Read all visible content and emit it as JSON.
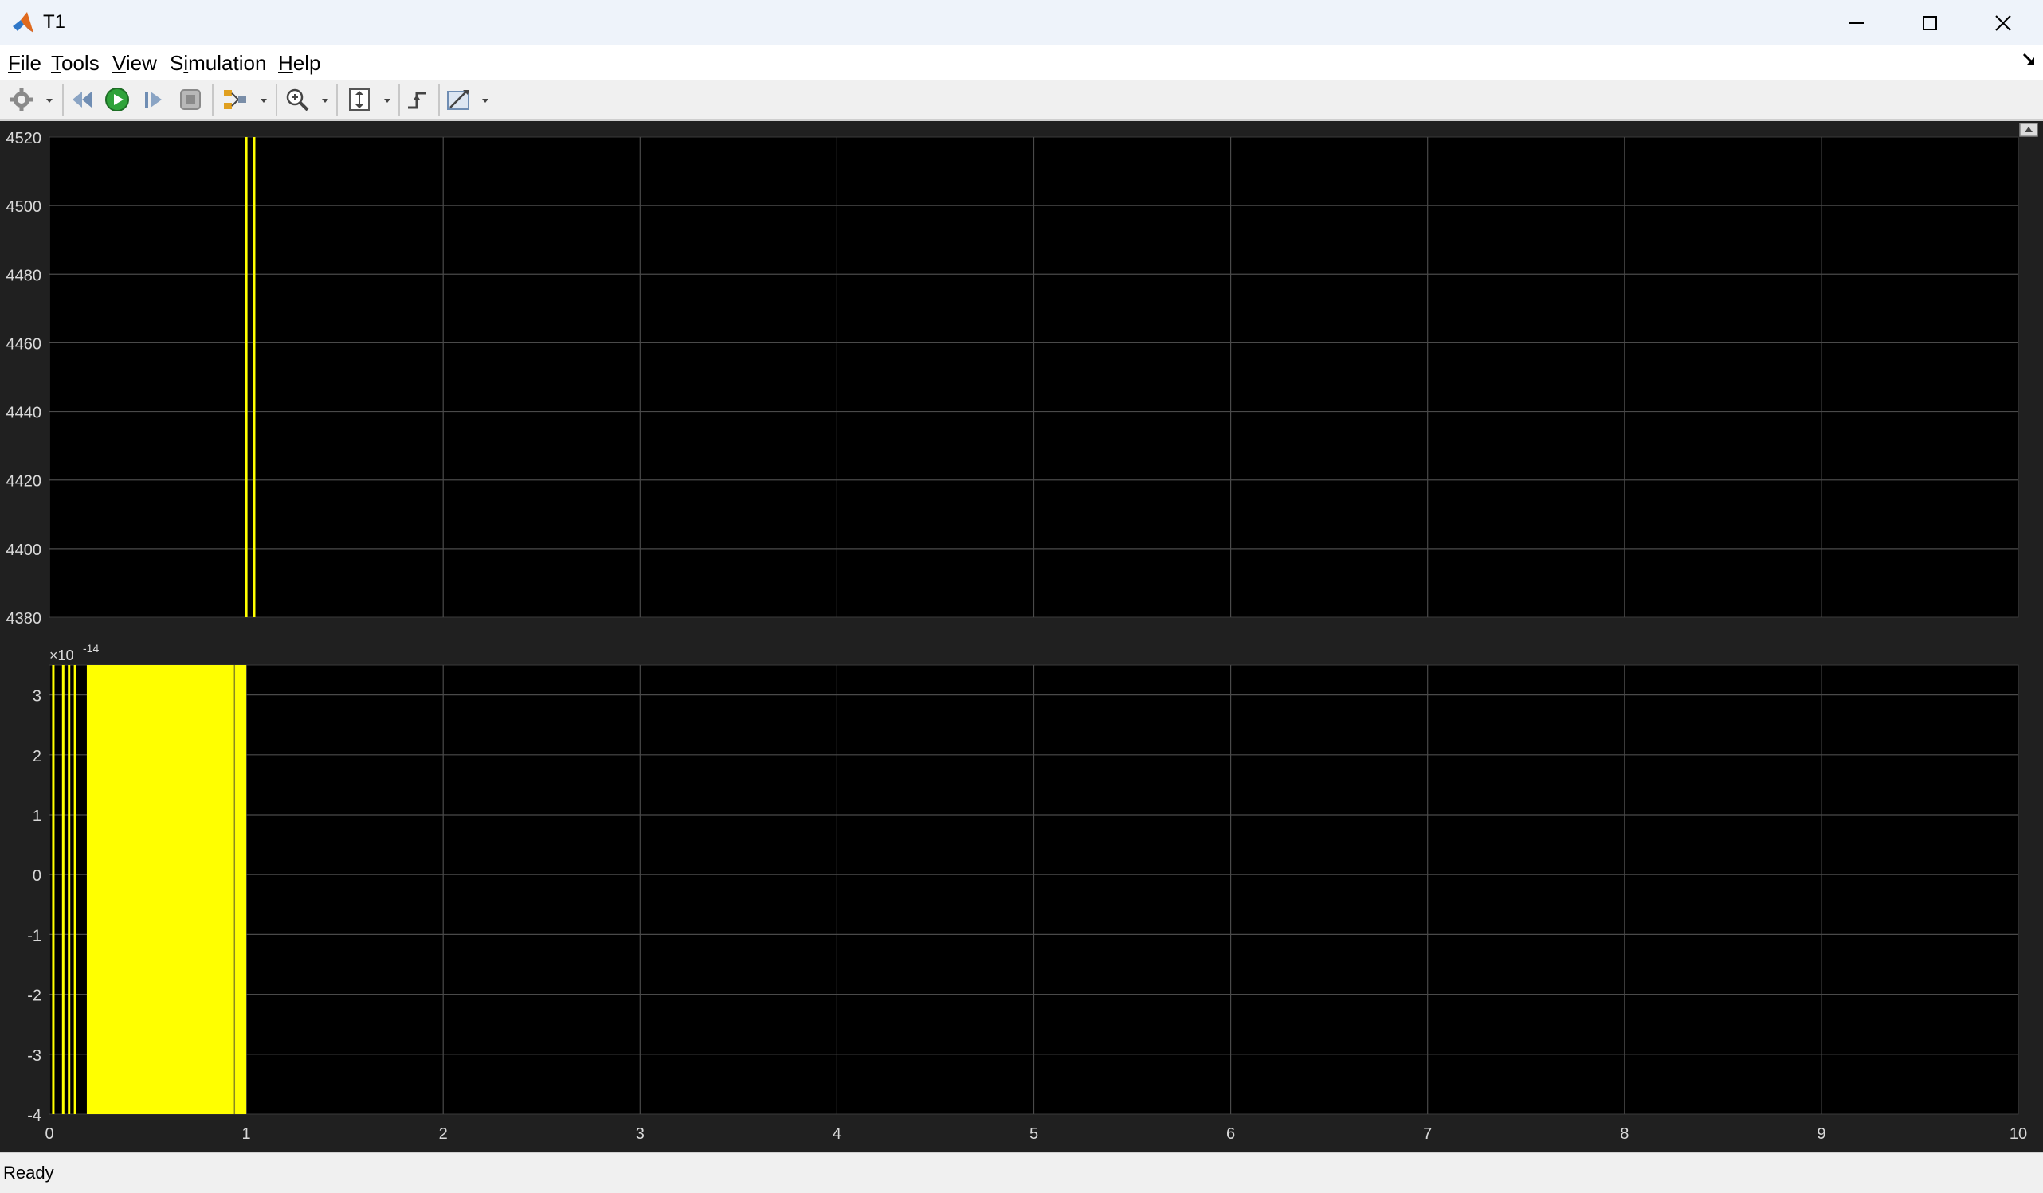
{
  "window": {
    "title": "T1"
  },
  "menu": [
    {
      "key": "F",
      "rest": "ile"
    },
    {
      "key": "T",
      "rest": "ools"
    },
    {
      "key": "V",
      "rest": "iew"
    },
    {
      "key": "",
      "pre": "S",
      "key2": "i",
      "rest": "mulation"
    },
    {
      "key": "H",
      "rest": "elp"
    }
  ],
  "toolbar": {
    "icons": [
      "settings-gear-icon",
      "step-back-icon",
      "run-icon",
      "step-forward-icon",
      "stop-icon",
      "signal-selector-icon",
      "zoom-in-icon",
      "scale-axes-icon",
      "triggers-icon",
      "measurements-icon"
    ]
  },
  "status": {
    "text": "Ready"
  },
  "colors": {
    "trace": "#ffff00",
    "axes_bg": "#000000",
    "grid": "#4a4a4a",
    "frame_bg": "#202020",
    "tick_text": "#d9d9d9"
  },
  "chart_data": [
    {
      "type": "line",
      "xlim": [
        0,
        10
      ],
      "ylim": [
        4380,
        4520
      ],
      "y_ticks": [
        "4520",
        "4500",
        "4480",
        "4460",
        "4440",
        "4420",
        "4400",
        "4380"
      ],
      "y_tick_values": [
        4520,
        4500,
        4480,
        4460,
        4440,
        4420,
        4400,
        4380
      ],
      "grid": true,
      "series": [
        {
          "segments": [
            [
              1.0,
              1.0
            ],
            [
              1.04,
              1.04
            ]
          ]
        }
      ]
    },
    {
      "type": "area",
      "xlim": [
        0,
        10
      ],
      "ylim": [
        -4,
        3.5
      ],
      "exponent_label": "×10",
      "exponent": "-14",
      "y_ticks": [
        "3",
        "2",
        "1",
        "0",
        "-1",
        "-2",
        "-3",
        "-4"
      ],
      "y_tick_values": [
        3,
        2,
        1,
        0,
        -1,
        -2,
        -3,
        -4
      ],
      "x_ticks": [
        "0",
        "1",
        "2",
        "3",
        "4",
        "5",
        "6",
        "7",
        "8",
        "9",
        "10"
      ],
      "x_tick_values": [
        0,
        1,
        2,
        3,
        4,
        5,
        6,
        7,
        8,
        9,
        10
      ],
      "grid": true,
      "series": [
        {
          "lines_x": [
            0.02,
            0.07,
            0.1,
            0.13
          ],
          "fill_x": [
            0.19,
            1.0
          ],
          "dark_line_x": 0.94
        }
      ]
    }
  ]
}
